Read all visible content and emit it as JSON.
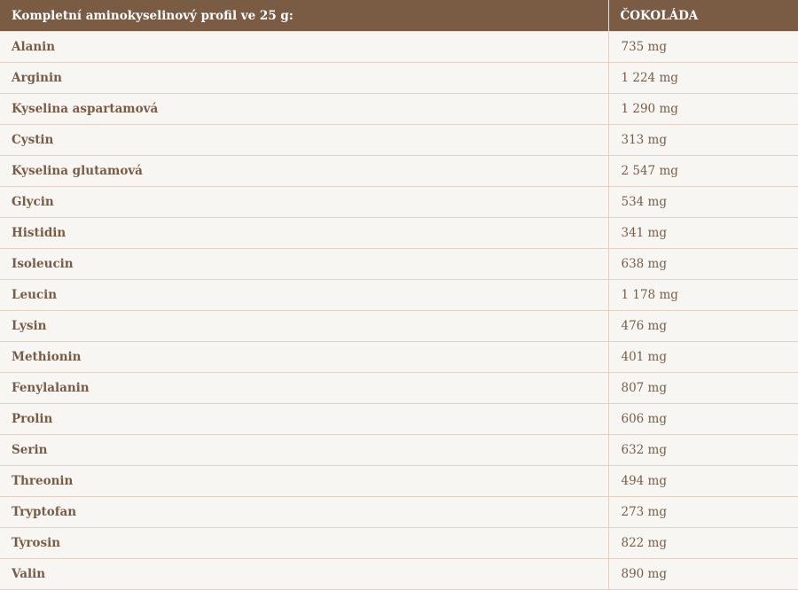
{
  "table": {
    "headers": [
      "Kompletní aminokyselinový profil ve 25 g:",
      "ČOKOLÁDA"
    ],
    "rows": [
      {
        "name": "Alanin",
        "value": "735 mg"
      },
      {
        "name": "Arginin",
        "value": "1 224 mg"
      },
      {
        "name": "Kyselina aspartamová",
        "value": "1 290 mg"
      },
      {
        "name": "Cystin",
        "value": "313 mg"
      },
      {
        "name": "Kyselina glutamová",
        "value": "2 547 mg"
      },
      {
        "name": "Glycin",
        "value": "534 mg"
      },
      {
        "name": "Histidin",
        "value": "341 mg"
      },
      {
        "name": "Isoleucin",
        "value": "638 mg"
      },
      {
        "name": "Leucin",
        "value": "1 178 mg"
      },
      {
        "name": "Lysin",
        "value": "476 mg"
      },
      {
        "name": "Methionin",
        "value": "401 mg"
      },
      {
        "name": "Fenylalanin",
        "value": "807 mg"
      },
      {
        "name": "Prolin",
        "value": "606 mg"
      },
      {
        "name": "Serin",
        "value": "632 mg"
      },
      {
        "name": "Threonin",
        "value": "494 mg"
      },
      {
        "name": "Tryptofan",
        "value": "273 mg"
      },
      {
        "name": "Tyrosin",
        "value": "822 mg"
      },
      {
        "name": "Valin",
        "value": "890 mg"
      }
    ]
  },
  "colors": {
    "header_bg": "#7a5c45",
    "row_bg": "#f8f6f2",
    "text": "#7a5c45",
    "border": "#dfd2c4"
  }
}
